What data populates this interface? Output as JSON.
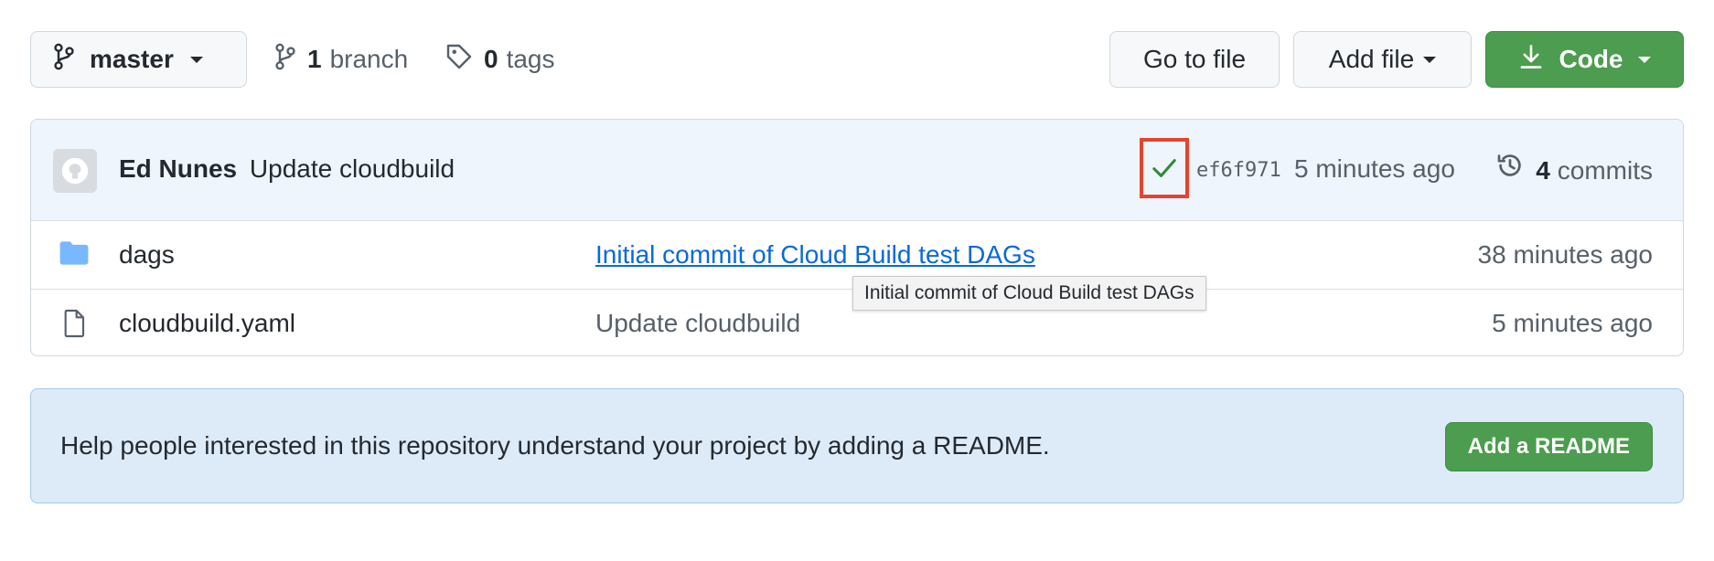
{
  "toolbar": {
    "branch_label": "master",
    "branches_count": "1",
    "branches_text": "branch",
    "tags_count": "0",
    "tags_text": "tags",
    "go_to_file": "Go to file",
    "add_file": "Add file",
    "code": "Code"
  },
  "commit": {
    "author": "Ed Nunes",
    "message": "Update cloudbuild",
    "sha": "ef6f971",
    "time": "5 minutes ago",
    "commits_count": "4",
    "commits_text": "commits",
    "status": "success"
  },
  "files": [
    {
      "type": "folder",
      "icon": "folder-icon",
      "name": "dags",
      "message": "Initial commit of Cloud Build test DAGs",
      "time": "38 minutes ago"
    },
    {
      "type": "file",
      "icon": "file-icon",
      "name": "cloudbuild.yaml",
      "message": "Update cloudbuild",
      "time": "5 minutes ago"
    }
  ],
  "tooltip": {
    "text": "Initial commit of Cloud Build test DAGs"
  },
  "readme": {
    "text": "Help people interested in this repository understand your project by adding a README.",
    "button": "Add a README"
  },
  "colors": {
    "accent_green": "#4c9d4f",
    "link_blue": "#0969da",
    "highlight_red": "#e2442f",
    "banner_blue": "#ddebf9"
  }
}
